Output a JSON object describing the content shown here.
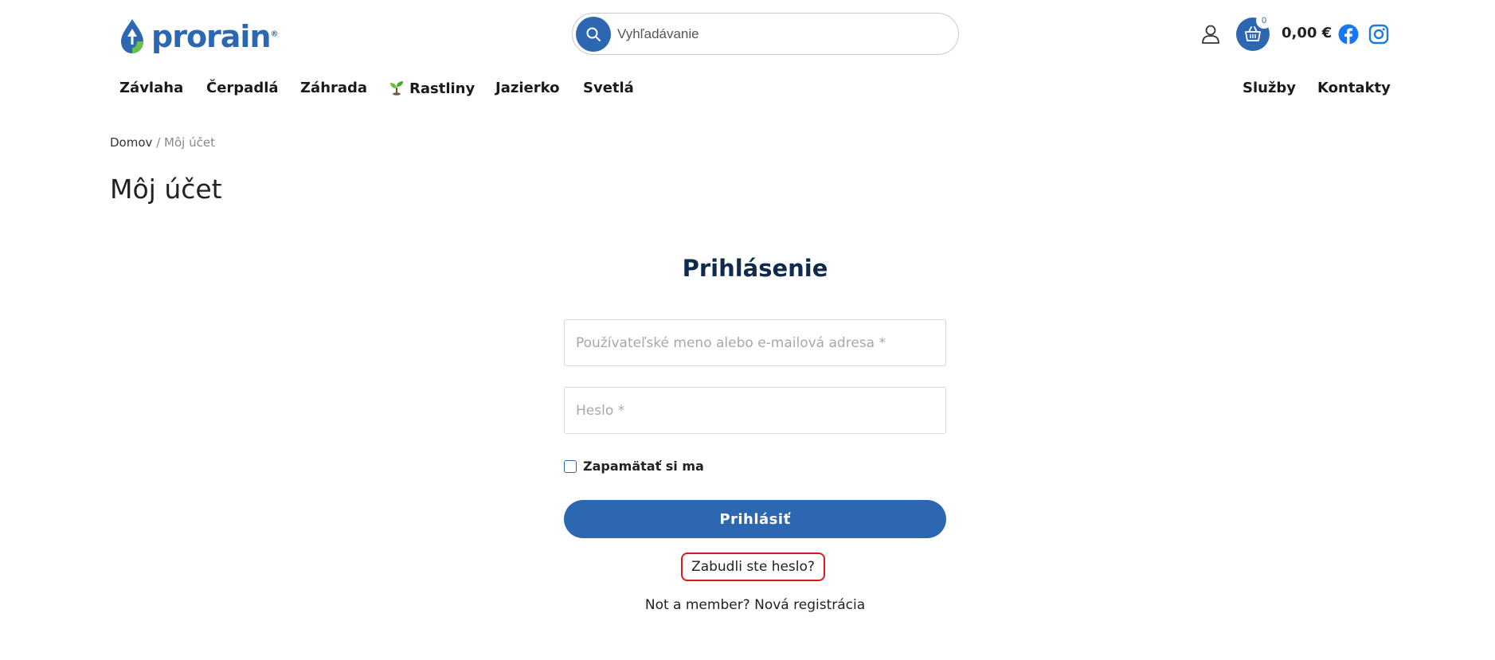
{
  "logo": {
    "text": "prorain",
    "mark": "®"
  },
  "search": {
    "placeholder": "Vyhľadávanie"
  },
  "cart": {
    "count": "0",
    "total": "0,00 €"
  },
  "nav": {
    "left": [
      "Závlaha",
      "Čerpadlá",
      "Záhrada",
      "Rastliny",
      "Jazierko",
      "Svetlá"
    ],
    "right": [
      "Služby",
      "Kontakty"
    ]
  },
  "breadcrumb": {
    "home": "Domov",
    "separator": "/",
    "current": "Môj účet"
  },
  "page_title": "Môj účet",
  "login": {
    "title": "Prihlásenie",
    "username_placeholder": "Používateľské meno alebo e-mailová adresa *",
    "password_placeholder": "Heslo *",
    "remember_label": "Zapamätať si ma",
    "submit_label": "Prihlásiť",
    "forgot_label": "Zabudli ste heslo?",
    "register_prefix": "Not a member?",
    "register_link": "Nová registrácia"
  },
  "colors": {
    "brand_blue": "#2e67b1",
    "brand_green": "#6cc04a",
    "title_navy": "#0f2a4d",
    "highlight_red": "#d7191c"
  },
  "icons": [
    "search-icon",
    "user-icon",
    "basket-icon",
    "facebook-icon",
    "instagram-icon",
    "sprout-icon"
  ]
}
